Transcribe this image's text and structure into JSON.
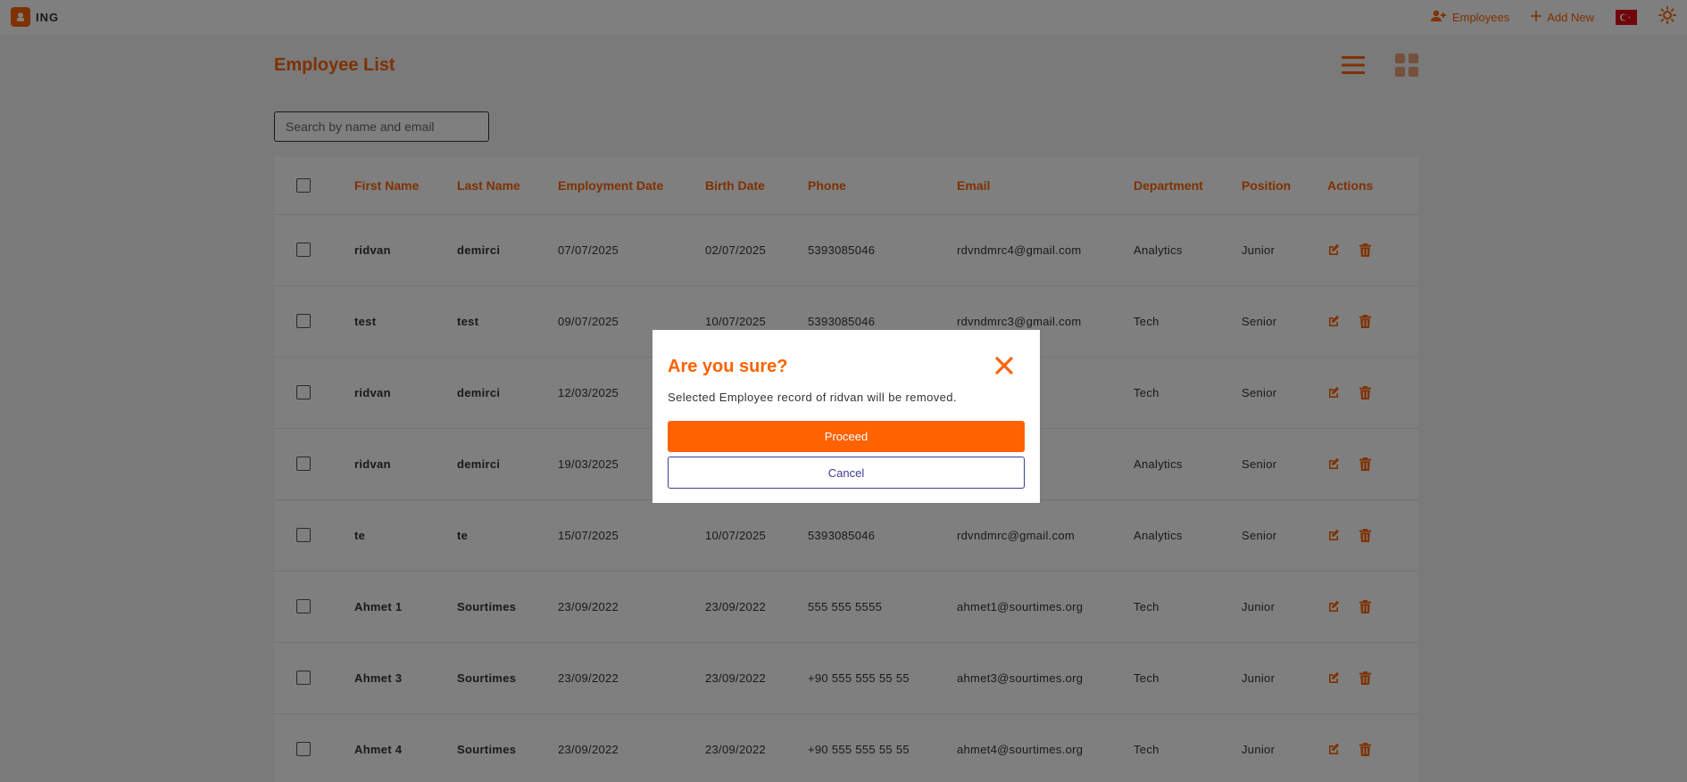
{
  "app": {
    "brand": "ING"
  },
  "nav": {
    "employees": "Employees",
    "add_new": "Add New"
  },
  "page": {
    "title": "Employee List"
  },
  "search": {
    "placeholder": "Search by name and email"
  },
  "table": {
    "headers": [
      "First Name",
      "Last Name",
      "Employment Date",
      "Birth Date",
      "Phone",
      "Email",
      "Department",
      "Position",
      "Actions"
    ],
    "rows": [
      [
        "ridvan",
        "demirci",
        "07/07/2025",
        "02/07/2025",
        "5393085046",
        "rdvndmrc4@gmail.com",
        "Analytics",
        "Junior"
      ],
      [
        "test",
        "test",
        "09/07/2025",
        "10/07/2025",
        "5393085046",
        "rdvndmrc3@gmail.com",
        "Tech",
        "Senior"
      ],
      [
        "ridvan",
        "demirci",
        "12/03/2025",
        "",
        "",
        "mail.com",
        "Tech",
        "Senior"
      ],
      [
        "ridvan",
        "demirci",
        "19/03/2025",
        "",
        "",
        "mail.com",
        "Analytics",
        "Senior"
      ],
      [
        "te",
        "te",
        "15/07/2025",
        "10/07/2025",
        "5393085046",
        "rdvndmrc@gmail.com",
        "Analytics",
        "Senior"
      ],
      [
        "Ahmet 1",
        "Sourtimes",
        "23/09/2022",
        "23/09/2022",
        "555 555 5555",
        "ahmet1@sourtimes.org",
        "Tech",
        "Junior"
      ],
      [
        "Ahmet 3",
        "Sourtimes",
        "23/09/2022",
        "23/09/2022",
        "+90 555 555 55 55",
        "ahmet3@sourtimes.org",
        "Tech",
        "Junior"
      ],
      [
        "Ahmet 4",
        "Sourtimes",
        "23/09/2022",
        "23/09/2022",
        "+90 555 555 55 55",
        "ahmet4@sourtimes.org",
        "Tech",
        "Junior"
      ]
    ]
  },
  "modal": {
    "title": "Are you sure?",
    "message": "Selected Employee record of ridvan will be removed.",
    "proceed": "Proceed",
    "cancel": "Cancel"
  },
  "colors": {
    "accent": "#ff6200",
    "cancel": "#3d3d99",
    "flag": "#e30a17"
  },
  "icons": [
    "logo-icon",
    "add-user-icon",
    "plus-icon",
    "flag-icon",
    "sun-icon",
    "list-view-icon",
    "grid-view-icon",
    "edit-icon",
    "trash-icon",
    "close-icon"
  ]
}
